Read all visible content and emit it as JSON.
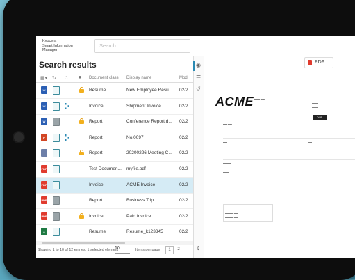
{
  "app": {
    "brand_lines": [
      "Kyocera",
      "Smart Information",
      "Manager"
    ],
    "search_placeholder": "Search"
  },
  "results": {
    "title": "Search results",
    "columns": {
      "document_class": "Document class",
      "display_name": "Display name",
      "modified": "Modi"
    },
    "rows": [
      {
        "file_type": "word",
        "file_label": "W",
        "pages": true,
        "extra": "none",
        "locked": true,
        "document_class": "Resume",
        "display_name": "New Employee Resu...",
        "modified": "02/2",
        "selected": false
      },
      {
        "file_type": "word",
        "file_label": "W",
        "pages": true,
        "extra": "workflow",
        "locked": false,
        "document_class": "Invoice",
        "display_name": "Shipment Invoice",
        "modified": "02/2",
        "selected": false
      },
      {
        "file_type": "word",
        "file_label": "W",
        "pages": false,
        "extra": "none",
        "locked": true,
        "document_class": "Report",
        "display_name": "Conference Report.d...",
        "modified": "02/2",
        "selected": false
      },
      {
        "file_type": "powerpoint",
        "file_label": "P",
        "pages": true,
        "extra": "workflow",
        "locked": false,
        "document_class": "Report",
        "display_name": "No.0097",
        "modified": "02/2",
        "selected": false
      },
      {
        "file_type": "image",
        "file_label": "",
        "pages": true,
        "extra": "none",
        "locked": true,
        "document_class": "Report",
        "display_name": "20200226 Meeting C...",
        "modified": "02/2",
        "selected": false
      },
      {
        "file_type": "pdf",
        "file_label": "PDF",
        "pages": true,
        "extra": "none",
        "locked": false,
        "document_class": "Test Documen...",
        "display_name": "myfile.pdf",
        "modified": "02/2",
        "selected": false
      },
      {
        "file_type": "pdf",
        "file_label": "PDF",
        "pages": true,
        "extra": "none",
        "locked": false,
        "document_class": "Invoice",
        "display_name": "ACME Invoice",
        "modified": "02/2",
        "selected": true
      },
      {
        "file_type": "pdf",
        "file_label": "PDF",
        "pages": false,
        "extra": "none",
        "locked": false,
        "document_class": "Report",
        "display_name": "Business Trip",
        "modified": "02/2",
        "selected": false
      },
      {
        "file_type": "pdf",
        "file_label": "PDF",
        "pages": false,
        "extra": "none",
        "locked": true,
        "document_class": "Invoice",
        "display_name": "Paid Invoice",
        "modified": "02/2",
        "selected": false
      },
      {
        "file_type": "excel",
        "file_label": "X",
        "pages": true,
        "extra": "none",
        "locked": false,
        "document_class": "Resume",
        "display_name": "Resume_k123345",
        "modified": "02/2",
        "selected": false
      }
    ],
    "footer_text": "Showing 1 to 10 of 12 entries, 1 selected element",
    "page_size": "10",
    "items_per_page_label": "Items per page",
    "pages": [
      "1",
      "2"
    ]
  },
  "preview": {
    "pdf_button_label": "PDF",
    "logo": "ACME",
    "due_label": "DUE"
  },
  "colors": {
    "word": "#2b5fb4",
    "powerpoint": "#d24625",
    "pdf": "#e03b2e",
    "excel": "#1f7a43",
    "image": "#6d7fa8",
    "selected_row": "#d5ebf5",
    "accent": "#2b8ab3"
  }
}
